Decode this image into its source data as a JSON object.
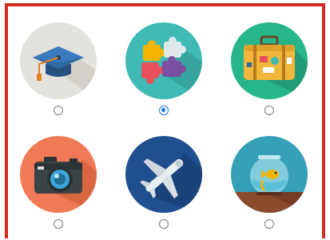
{
  "form": {
    "options": [
      {
        "icon": "graduation-cap-icon",
        "bg": "#e4e2dc",
        "selected": false
      },
      {
        "icon": "puzzle-pieces-icon",
        "bg": "#3fbab4",
        "selected": true
      },
      {
        "icon": "suitcase-icon",
        "bg": "#27b58a",
        "selected": false
      },
      {
        "icon": "camera-icon",
        "bg": "#f07a55",
        "selected": false
      },
      {
        "icon": "airplane-icon",
        "bg": "#1f4f8f",
        "selected": false
      },
      {
        "icon": "fishbowl-icon",
        "bg": "#35a0b8",
        "selected": false
      }
    ]
  },
  "colors": {
    "frame": "#d32a1e",
    "radio_selected": "#1a73e8",
    "radio_border": "#7a7a7a"
  }
}
